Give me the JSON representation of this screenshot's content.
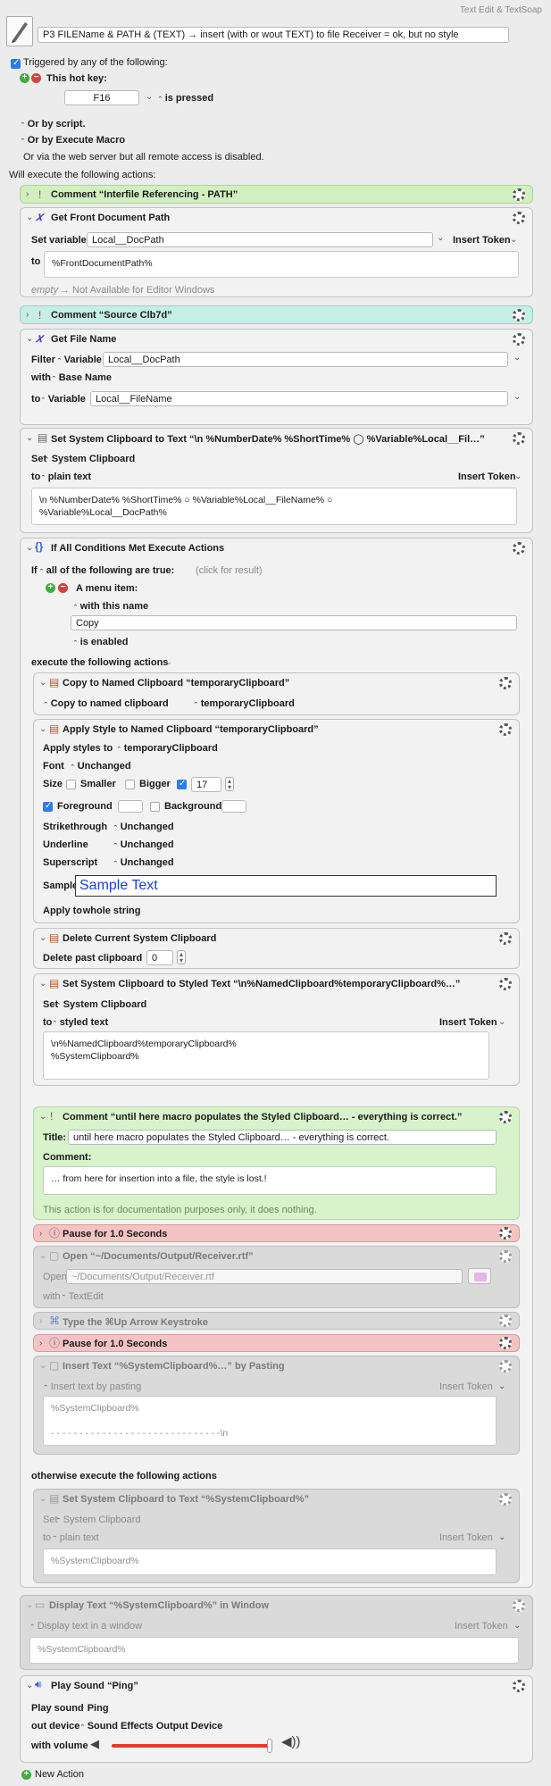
{
  "app": {
    "title": "Text Edit & TextSoap"
  },
  "macro": {
    "name": "P3 FILEName & PATH & (TEXT)  → insert (with or wout TEXT) to file Receiver = ok, but no style"
  },
  "triggers": {
    "triggered_label": "Triggered by any of the following:",
    "hotkey_label": "This hot key:",
    "hotkey_value": "F16",
    "hotkey_state": "is pressed",
    "or_script": "Or by script.",
    "or_execute": "Or by Execute Macro",
    "web": "Or via the web server but all remote access is disabled.",
    "will_execute": "Will execute the following actions:"
  },
  "a1": {
    "title": "Comment “Interfile Referencing  - PATH”"
  },
  "a2": {
    "title": "Get Front Document Path",
    "set_label": "Set variable",
    "var": "Local__DocPath",
    "insert_token": "Insert Token",
    "to_label": "to",
    "value": "%FrontDocumentPath%",
    "empty_label": "empty",
    "empty_note": "→ Not Available for Editor Windows"
  },
  "a3": {
    "title": "Comment “Source Clb7d”"
  },
  "a4": {
    "title": "Get File Name",
    "filter": "Filter",
    "variable1": "Variable",
    "var1": "Local__DocPath",
    "with": "with",
    "with_value": "Base Name",
    "to": "to",
    "variable2": "Variable",
    "var2": "Local__FileName"
  },
  "a5": {
    "title": "Set System Clipboard to Text “\\n %NumberDate% %ShortTime% ◯ %Variable%Local__Fil…”",
    "set": "Set",
    "set_value": "System Clipboard",
    "to": "to",
    "to_value": "plain text",
    "insert_token": "Insert Token",
    "text": "\\n %NumberDate% %ShortTime% ○ %Variable%Local__FileName% ○\n%Variable%Local__DocPath%"
  },
  "a6": {
    "title": "If All Conditions Met Execute Actions",
    "if": "If",
    "cond_mode": "all of the following are true:",
    "click_result": "(click for result)",
    "menu_item": "A menu item:",
    "with_name": "with this name",
    "name_value": "Copy",
    "is_enabled": "is enabled",
    "execute_label": "execute the following actions",
    "otherwise_label": "otherwise execute the following actions"
  },
  "b1": {
    "title": "Copy to Named Clipboard “temporaryClipboard”",
    "mode": "Copy to named clipboard",
    "clip": "temporaryClipboard"
  },
  "b2": {
    "title": "Apply Style to Named Clipboard “temporaryClipboard”",
    "apply_label": "Apply styles to",
    "apply_value": "temporaryClipboard",
    "font_label": "Font",
    "font_value": "Unchanged",
    "size_label": "Size",
    "smaller": "Smaller",
    "bigger": "Bigger",
    "size_value": "17",
    "foreground": "Foreground",
    "background": "Background",
    "strike_label": "Strikethrough",
    "strike_value": "Unchanged",
    "underline_label": "Underline",
    "underline_value": "Unchanged",
    "super_label": "Superscript",
    "super_value": "Unchanged",
    "sample_label": "Sample:",
    "sample_value": "Sample Text",
    "apply_to_label": "Apply to",
    "apply_to_value": "whole string"
  },
  "b3": {
    "title": "Delete Current System Clipboard",
    "label": "Delete past clipboard",
    "value": "0"
  },
  "b4": {
    "title": "Set System Clipboard to Styled Text “\\n%NamedClipboard%temporaryClipboard%…”",
    "set": "Set",
    "set_value": "System Clipboard",
    "to": "to",
    "to_value": "styled text",
    "insert_token": "Insert Token",
    "text": "\\n%NamedClipboard%temporaryClipboard%\n%SystemClipboard%"
  },
  "b5": {
    "title": "Comment “until here macro populates the Styled Clipboard… - everything is correct.”",
    "title_label": "Title:",
    "title_value": "until here macro populates the Styled Clipboard… - everything is correct.",
    "comment_label": "Comment:",
    "comment_value": "… from here for insertion into a file, the style is lost.!",
    "doc_note": "This action is for documentation purposes only, it does nothing."
  },
  "b6": {
    "title": "Pause for 1.0 Seconds"
  },
  "b7": {
    "title": "Open “~/Documents/Output/Receiver.rtf”",
    "open_label": "Open",
    "path": "~/Documents/Output/Receiver.rtf",
    "with_label": "with",
    "with_value": "TextEdit"
  },
  "b8": {
    "title": "Type the ⌘Up Arrow Keystroke"
  },
  "b9": {
    "title": "Pause for 1.0 Seconds"
  },
  "b10": {
    "title": "Insert Text “%SystemClipboard%…” by Pasting",
    "mode": "Insert text by pasting",
    "insert_token": "Insert Token",
    "text": "%SystemClipboard%\n\n- - - - - - - - - - - - - - - - - - - - - - - - - - - - - -\\n"
  },
  "b11": {
    "title": "Set System Clipboard to Text “%SystemClipboard%”",
    "set": "Set",
    "set_value": "System Clipboard",
    "to": "to",
    "to_value": "plain text",
    "insert_token": "Insert Token",
    "text": "%SystemClipboard%"
  },
  "a7": {
    "title": "Display Text “%SystemClipboard%” in Window",
    "mode": "Display text in a window",
    "insert_token": "Insert Token",
    "text": "%SystemClipboard%"
  },
  "a8": {
    "title": "Play Sound “Ping”",
    "play_label": "Play sound",
    "sound": "Ping",
    "out_label": "out device",
    "device": "Sound Effects Output Device",
    "volume_label": "with volume",
    "volume": 1.0
  },
  "footer": {
    "new_action": "New Action"
  },
  "colors": {
    "accent": "#2b7bf1",
    "comment_green": "#d2efc2",
    "comment_teal": "#c7eee6",
    "pause_red": "#f4c4c4",
    "volume_red": "#e83a2c"
  }
}
